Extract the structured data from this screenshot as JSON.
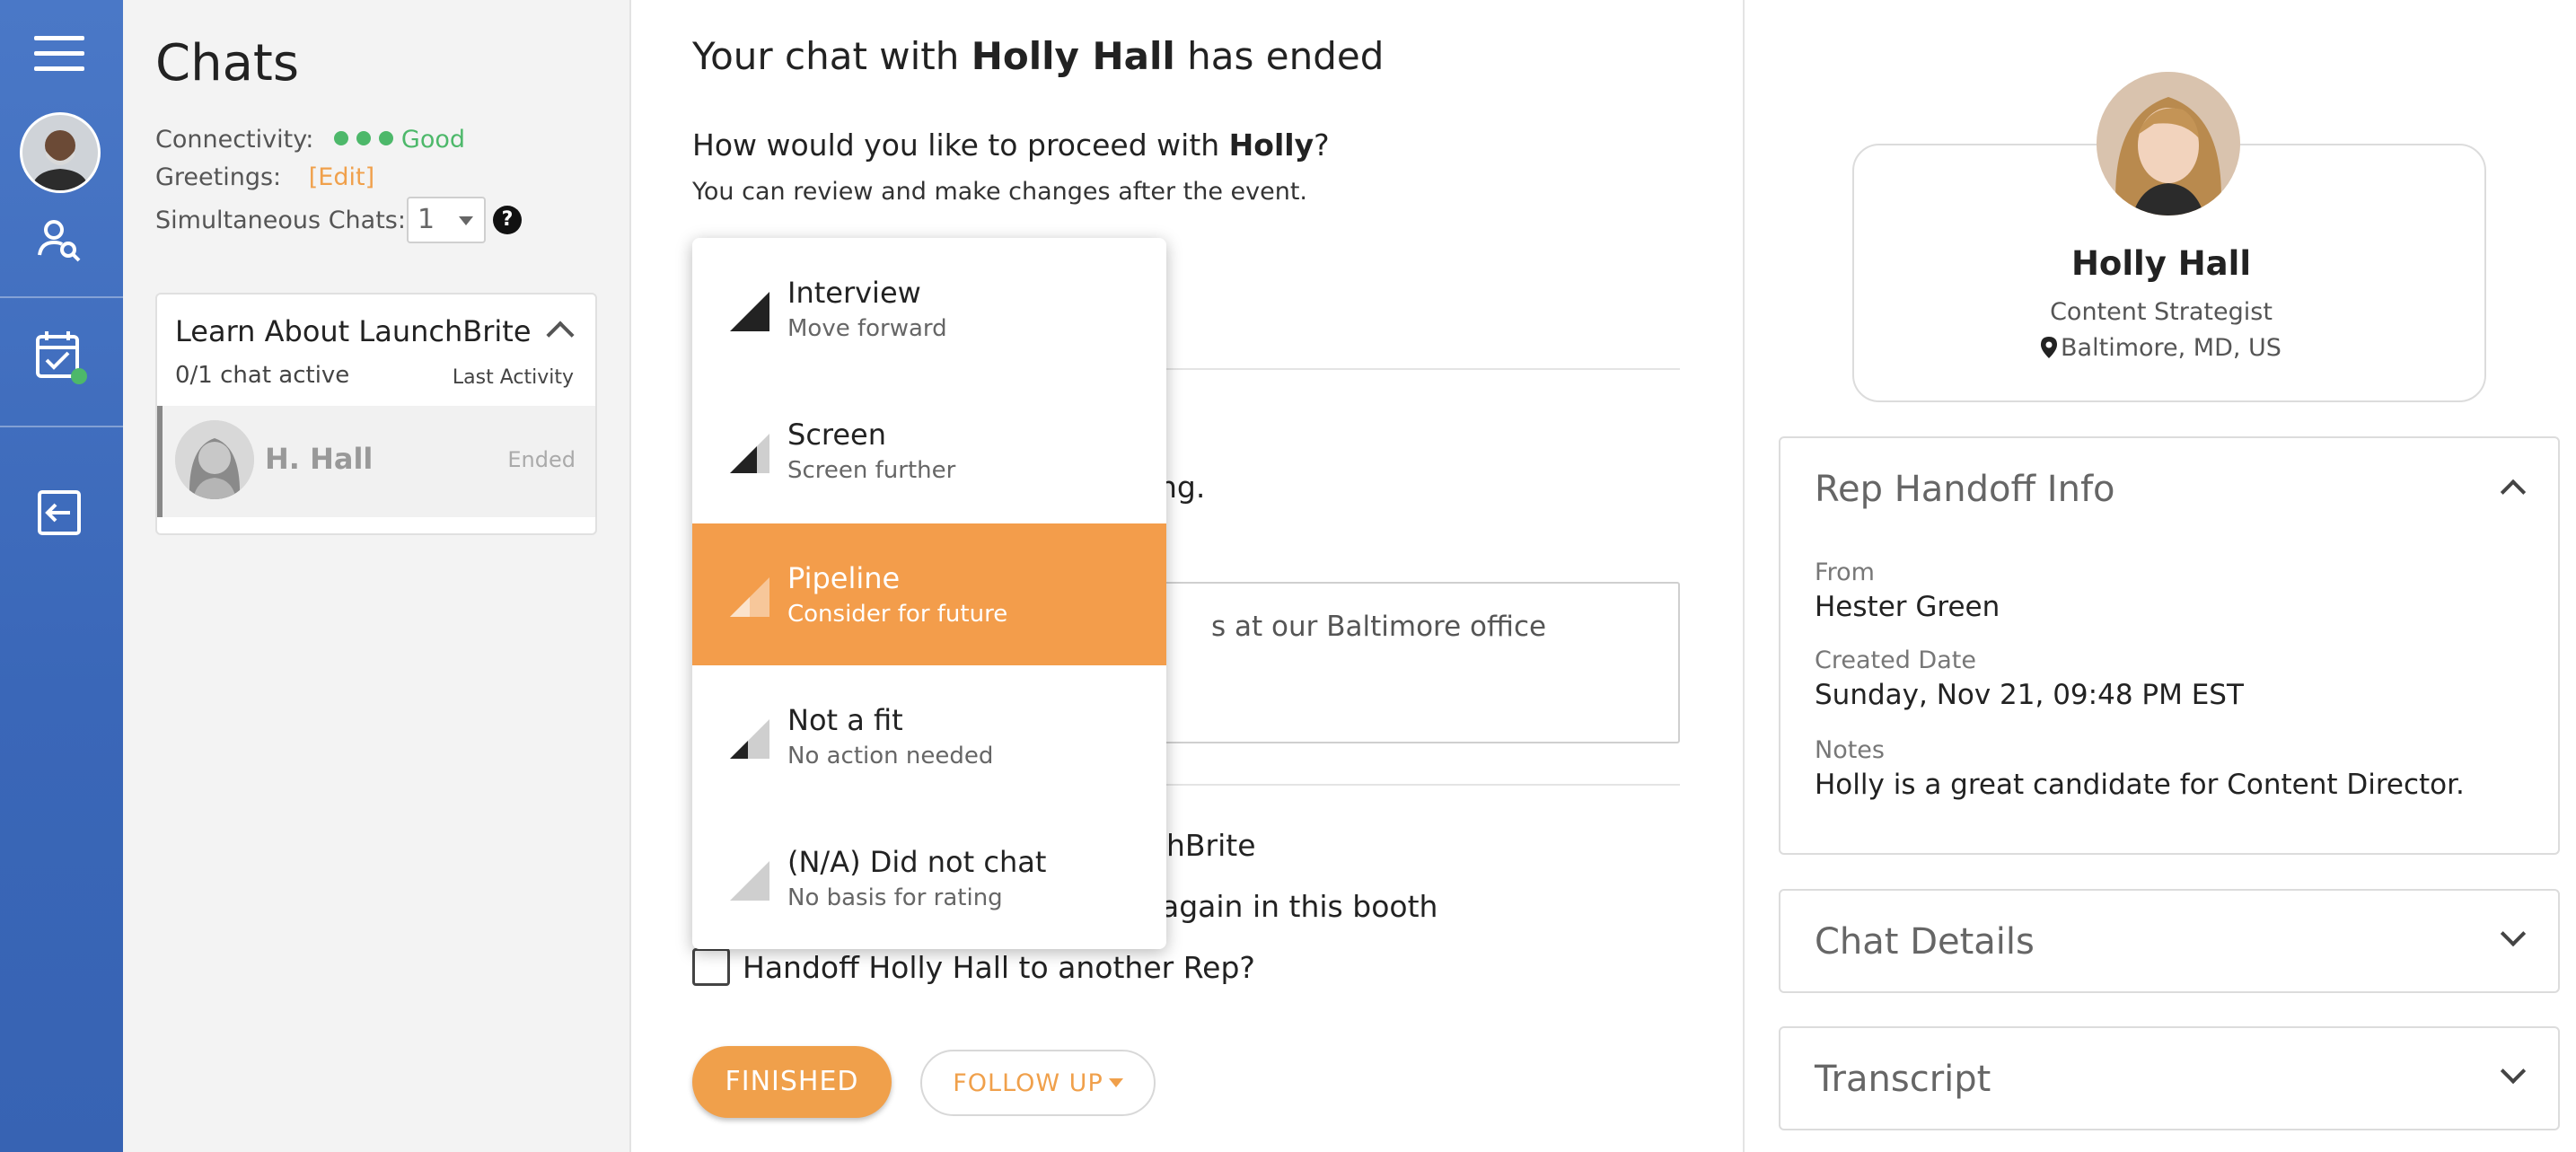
{
  "sidebar_rail": {
    "icons": [
      "menu-icon",
      "user-avatar",
      "user-search-icon",
      "calendar-check-icon",
      "logout-icon"
    ],
    "status_color": "#4db86a"
  },
  "chats_panel": {
    "title": "Chats",
    "connectivity_label": "Connectivity:",
    "connectivity_status": "Good",
    "greetings_label": "Greetings:",
    "greetings_edit": "[Edit]",
    "simultaneous_label": "Simultaneous Chats:",
    "simultaneous_value": "1",
    "help_glyph": "?",
    "group": {
      "title": "Learn About LaunchBrite",
      "active": "0/1 chat active",
      "last_activity": "Last Activity",
      "chat": {
        "name": "H. Hall",
        "status": "Ended"
      }
    }
  },
  "main": {
    "headline_pre": "Your chat with ",
    "headline_name": "Holly Hall",
    "headline_post": " has ended",
    "question_pre": "How would you like to proceed with ",
    "question_name": "Holly",
    "question_post": "?",
    "question_sub": "You can review and make changes after the event.",
    "partial_line": "ng.",
    "notes_partial": "s at our Baltimore office",
    "checkbox1_partial": "hBrite",
    "checkbox2_partial": "again in this booth",
    "handoff_label": "Handoff Holly Hall to another Rep?",
    "finished_label": "FINISHED",
    "follow_up_label": "FOLLOW UP"
  },
  "dropdown": {
    "options": [
      {
        "title": "Interview",
        "subtitle": "Move forward",
        "level": 4,
        "selected": false
      },
      {
        "title": "Screen",
        "subtitle": "Screen further",
        "level": 3,
        "selected": false
      },
      {
        "title": "Pipeline",
        "subtitle": "Consider for future",
        "level": 2,
        "selected": true
      },
      {
        "title": "Not a fit",
        "subtitle": "No action needed",
        "level": 1,
        "selected": false
      },
      {
        "title": "(N/A) Did not chat",
        "subtitle": "No basis for rating",
        "level": 0,
        "selected": false
      }
    ],
    "accent": "#f39d4b"
  },
  "profile": {
    "name": "Holly Hall",
    "title": "Content Strategist",
    "location": "Baltimore, MD, US"
  },
  "handoff_info": {
    "heading": "Rep Handoff Info",
    "from_label": "From",
    "from_value": "Hester Green",
    "date_label": "Created Date",
    "date_value": "Sunday, Nov 21, 09:48 PM EST",
    "notes_label": "Notes",
    "notes_value": "Holly is a great candidate for Content Director."
  },
  "chat_details": {
    "heading": "Chat Details"
  },
  "transcript": {
    "heading": "Transcript"
  }
}
